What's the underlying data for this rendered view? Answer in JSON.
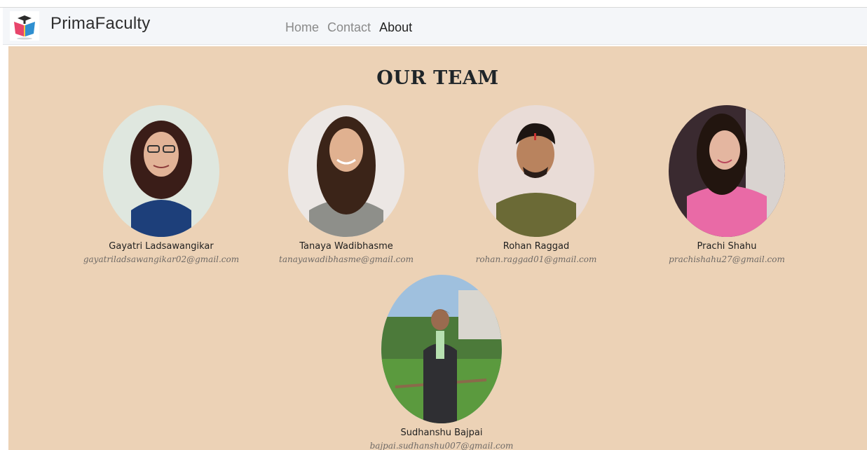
{
  "brand": {
    "name": "PrimaFaculty"
  },
  "nav": {
    "items": [
      {
        "label": "Home"
      },
      {
        "label": "Contact"
      },
      {
        "label": "About"
      }
    ]
  },
  "main": {
    "title": "OUR TEAM",
    "members": [
      {
        "name": "Gayatri Ladsawangikar",
        "email": "gayatriladsawangikar02@gmail.com"
      },
      {
        "name": "Tanaya Wadibhasme",
        "email": "tanayawadibhasme@gmail.com"
      },
      {
        "name": "Rohan Raggad",
        "email": "rohan.raggad01@gmail.com"
      },
      {
        "name": "Prachi Shahu",
        "email": "prachishahu27@gmail.com"
      },
      {
        "name": "Sudhanshu Bajpai",
        "email": "bajpai.sudhanshu007@gmail.com"
      }
    ]
  },
  "colors": {
    "content_bg": "#ecd2b6",
    "navbar_bg": "#f4f6f9"
  }
}
